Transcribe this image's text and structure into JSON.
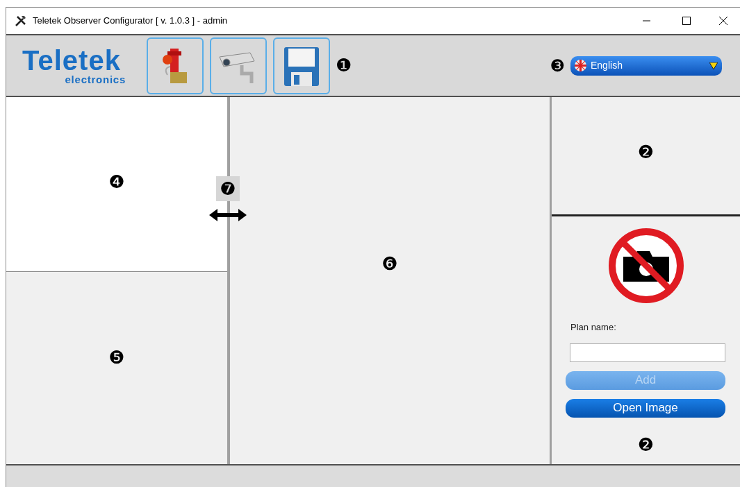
{
  "window": {
    "title": "Teletek Observer Configurator [ v. 1.0.3 ] - admin"
  },
  "toolbar": {
    "logo": {
      "name": "Teletek",
      "subtitle": "electronics"
    },
    "buttons": [
      {
        "kind": "fire"
      },
      {
        "kind": "camera"
      },
      {
        "kind": "save"
      }
    ],
    "callout": "❶",
    "language": {
      "callout": "❸",
      "value": "English"
    }
  },
  "left_top": {
    "callout": "❹"
  },
  "left_bottom": {
    "callout": "❺"
  },
  "splitter": {
    "callout": "❼"
  },
  "center": {
    "callout": "❻"
  },
  "right_top": {
    "callout": "❷"
  },
  "right_bottom": {
    "label": "Plan name:",
    "buttons": [
      {
        "label": "Add",
        "disabled": true
      },
      {
        "label": "Open Image",
        "disabled": false
      }
    ],
    "callout": "❷"
  }
}
